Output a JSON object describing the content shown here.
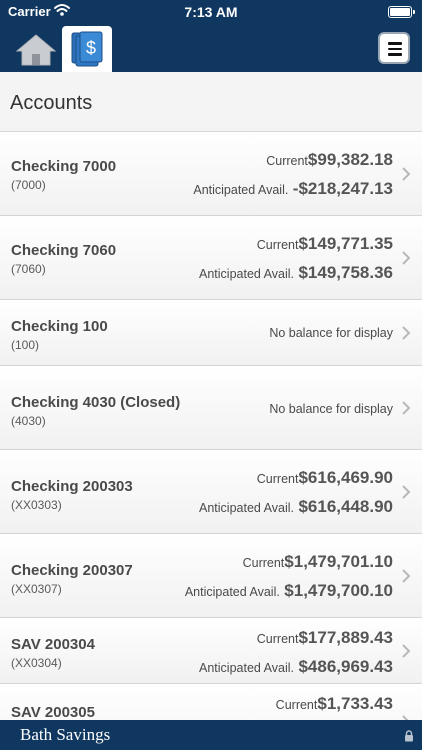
{
  "status_bar": {
    "carrier": "Carrier",
    "time": "7:13 AM"
  },
  "nav": {
    "icons": [
      "home-icon",
      "dollar-accounts-icon",
      "hamburger-menu-icon"
    ]
  },
  "page": {
    "title": "Accounts"
  },
  "accounts": [
    {
      "name": "Checking 7000",
      "number": "(7000)",
      "current_label": "Current",
      "current": "$99,382.18",
      "anticipated_label": "Anticipated Avail.",
      "anticipated": "-$218,247.13"
    },
    {
      "name": "Checking 7060",
      "number": "(7060)",
      "current_label": "Current",
      "current": "$149,771.35",
      "anticipated_label": "Anticipated Avail.",
      "anticipated": "$149,758.36"
    },
    {
      "name": "Checking 100",
      "number": "(100)",
      "no_balance": "No balance for display"
    },
    {
      "name": "Checking 4030 (Closed)",
      "number": "(4030)",
      "no_balance": "No balance for display"
    },
    {
      "name": "Checking 200303",
      "number": "(XX0303)",
      "current_label": "Current",
      "current": "$616,469.90",
      "anticipated_label": "Anticipated Avail.",
      "anticipated": "$616,448.90"
    },
    {
      "name": "Checking 200307",
      "number": "(XX0307)",
      "current_label": "Current",
      "current": "$1,479,701.10",
      "anticipated_label": "Anticipated Avail.",
      "anticipated": "$1,479,700.10"
    },
    {
      "name": "SAV 200304",
      "number": "(XX0304)",
      "current_label": "Current",
      "current": "$177,889.43",
      "anticipated_label": "Anticipated Avail.",
      "anticipated": "$486,969.43"
    },
    {
      "name": "SAV 200305",
      "number": "",
      "current_label": "Current",
      "current": "$1,733.43"
    }
  ],
  "footer": {
    "brand": "Bath Savings"
  },
  "colors": {
    "navy": "#0f3760",
    "accent_blue": "#2c6fb8"
  }
}
